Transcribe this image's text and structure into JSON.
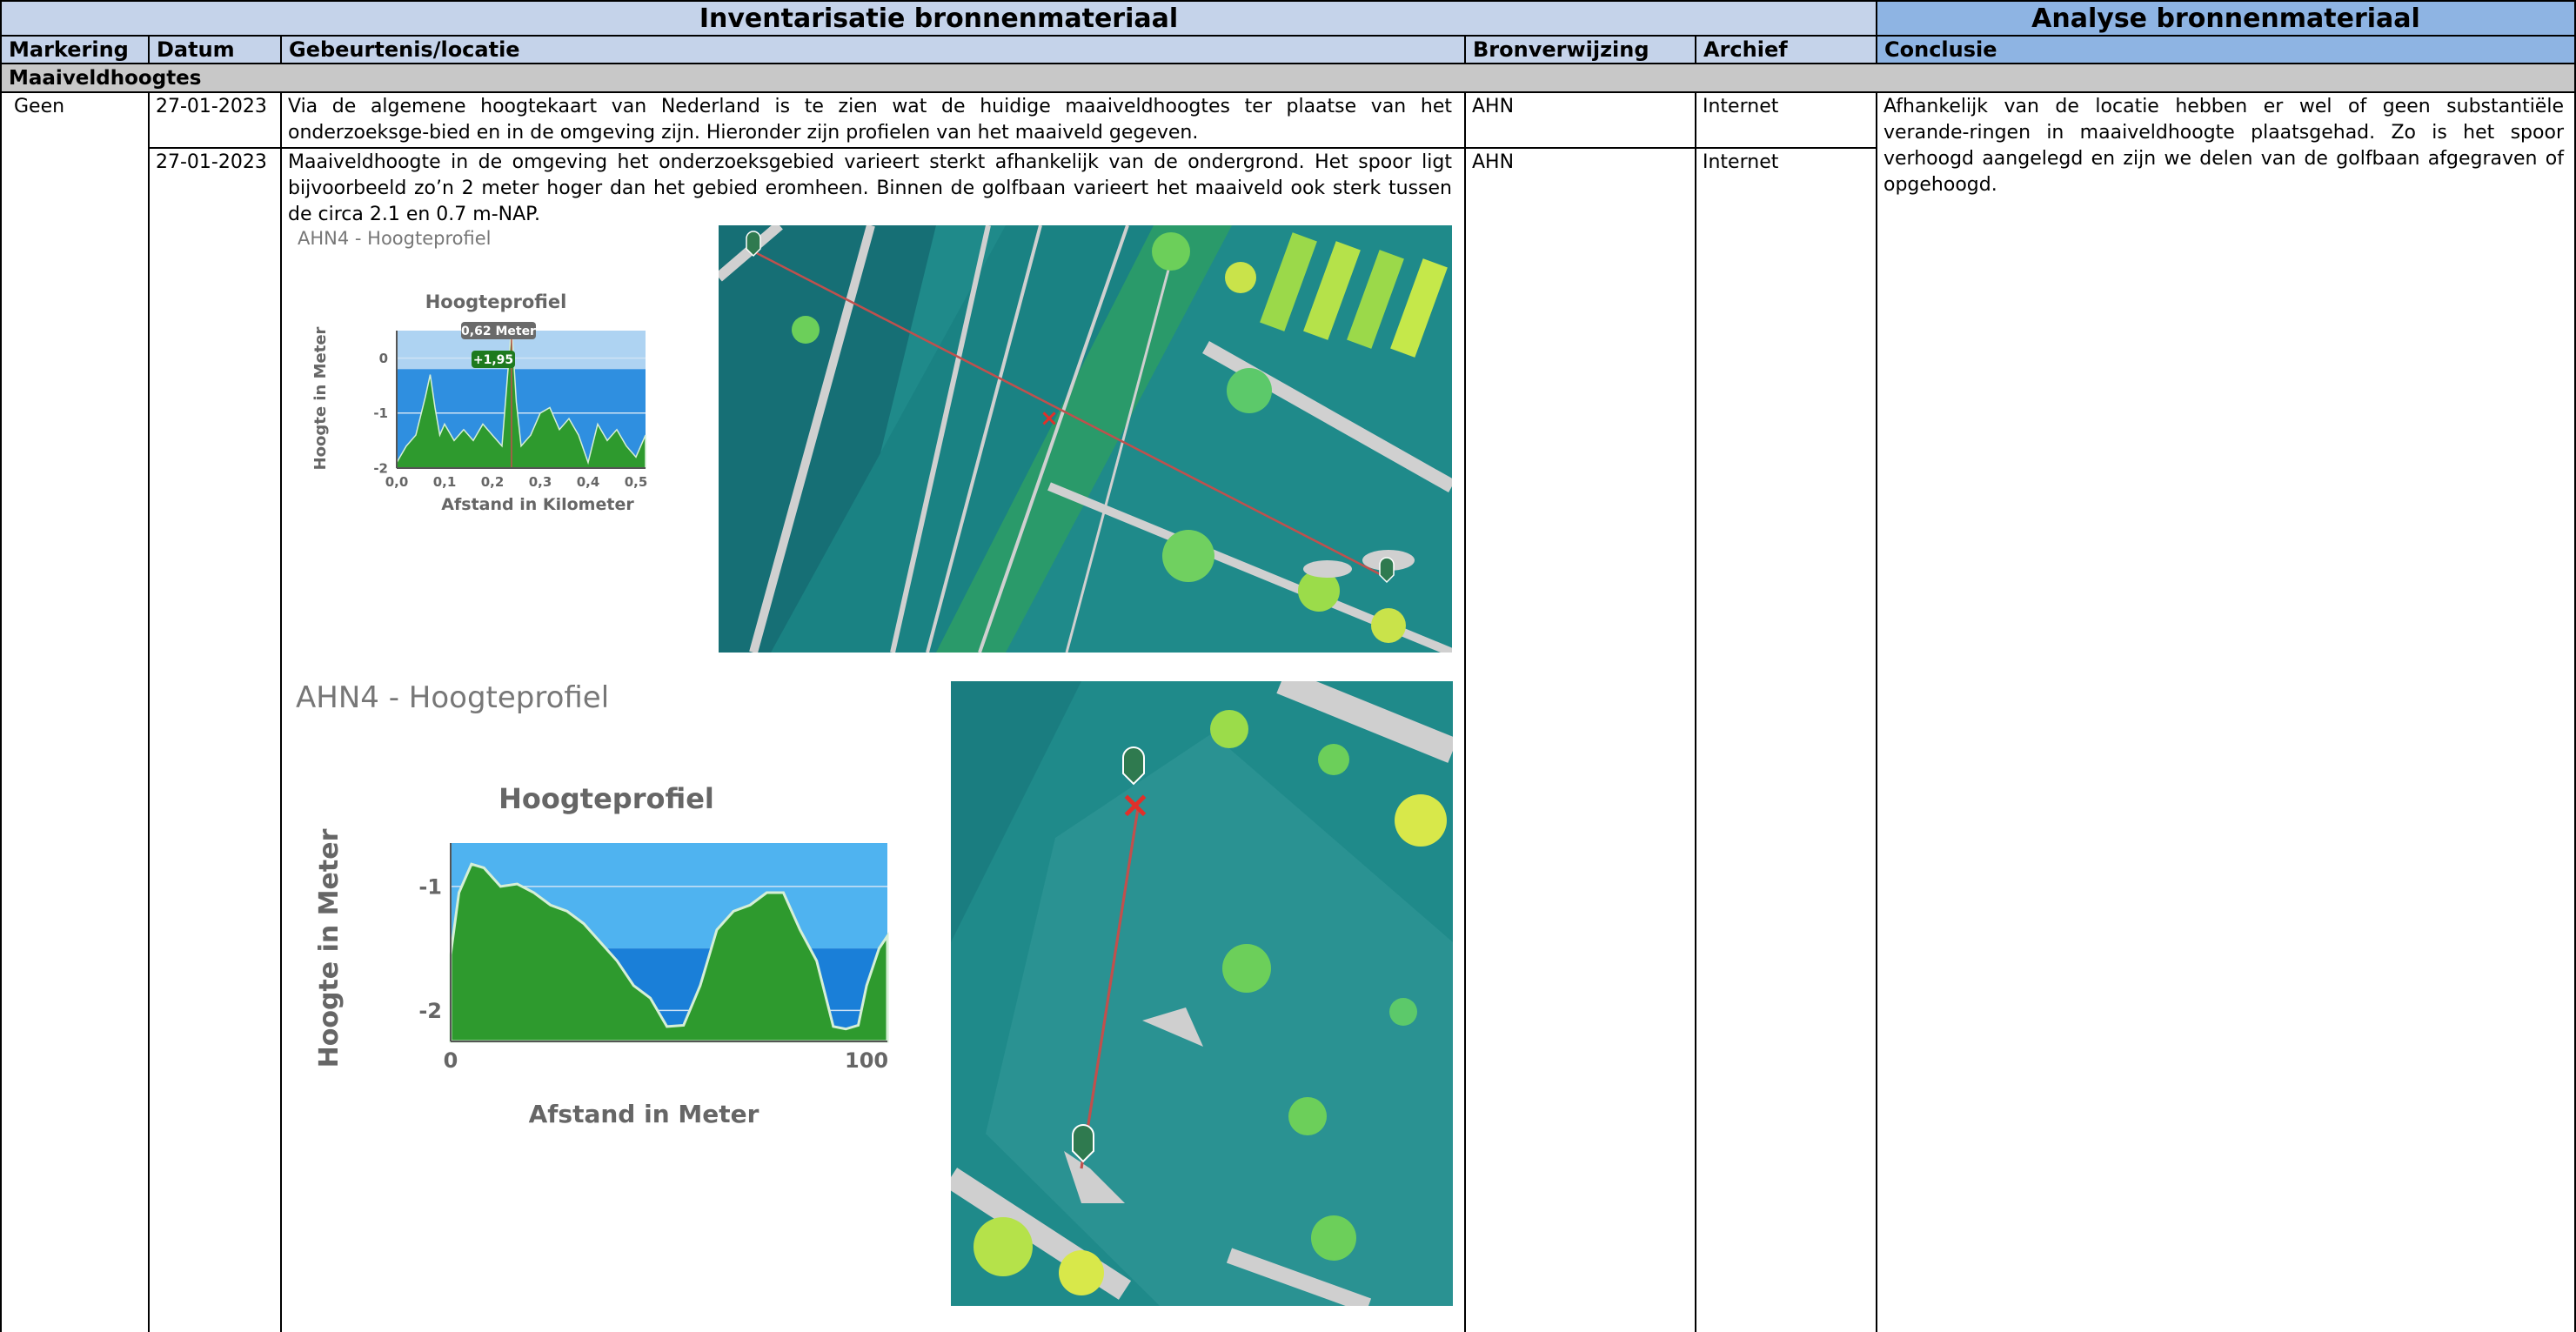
{
  "header": {
    "inventarisatie": "Inventarisatie bronnenmateriaal",
    "analyse": "Analyse bronnenmateriaal"
  },
  "columns": {
    "markering": "Markering",
    "datum": "Datum",
    "gebeurtenis": "Gebeurtenis/locatie",
    "bronverwijzing": "Bronverwijzing",
    "archief": "Archief",
    "conclusie": "Conclusie"
  },
  "section": "Maaiveldhoogtes",
  "rows": [
    {
      "markering": "Geen",
      "datum": "27-01-2023",
      "gebeurtenis": "Via de algemene hoogtekaart van Nederland is te zien wat de huidige maaiveldhoogtes ter plaatse van het onderzoeksge-bied en in de omgeving zijn. Hieronder zijn profielen van het maaiveld gegeven.",
      "bron": "AHN",
      "archief": "Internet"
    },
    {
      "datum": "27-01-2023",
      "gebeurtenis": "Maaiveldhoogte in de omgeving het onderzoeksgebied varieert sterkt afhankelijk van de ondergrond. Het spoor ligt bijvoorbeeld zo’n 2 meter hoger dan het gebied eromheen. Binnen de golfbaan varieert het maaiveld ook sterk tussen de circa 2.1 en 0.7 m-NAP.",
      "bron": "AHN",
      "archief": "Internet"
    }
  ],
  "conclusie": "Afhankelijk van de locatie hebben er wel of geen substantiële verande-ringen in maaiveldhoogte plaatsgehad. Zo is het spoor verhoogd aangelegd en zijn we delen van de golfbaan afgegraven of opgehoogd.",
  "profiles": [
    {
      "panel_title": "AHN4 - Hoogteprofiel",
      "chart_title": "Hoogteprofiel",
      "ylabel": "Hoogte in Meter",
      "xlabel": "Afstand in Kilometer",
      "yticks": [
        "0",
        "-1",
        "-2"
      ],
      "xticks": [
        "0,0",
        "0,1",
        "0,2",
        "0,3",
        "0,4",
        "0,5"
      ],
      "tooltip": "0,62 Meter",
      "badge": "+1,95"
    },
    {
      "panel_title": "AHN4 - Hoogteprofiel",
      "chart_title": "Hoogteprofiel",
      "ylabel": "Hoogte in Meter",
      "xlabel": "Afstand in Meter",
      "yticks": [
        "-1",
        "-2"
      ],
      "xticks": [
        "0",
        "100"
      ]
    }
  ],
  "chart_data": [
    {
      "type": "area",
      "title": "Hoogteprofiel",
      "xlabel": "Afstand in Kilometer",
      "ylabel": "Hoogte in Meter",
      "xlim": [
        0,
        0.52
      ],
      "ylim": [
        -2,
        0.5
      ],
      "x": [
        0.0,
        0.02,
        0.04,
        0.06,
        0.07,
        0.08,
        0.09,
        0.1,
        0.12,
        0.14,
        0.16,
        0.18,
        0.2,
        0.22,
        0.23,
        0.24,
        0.25,
        0.26,
        0.28,
        0.3,
        0.32,
        0.34,
        0.36,
        0.38,
        0.4,
        0.42,
        0.44,
        0.46,
        0.48,
        0.5,
        0.52
      ],
      "y": [
        -1.9,
        -1.6,
        -1.4,
        -0.7,
        -0.3,
        -0.9,
        -1.4,
        -1.2,
        -1.5,
        -1.3,
        -1.5,
        -1.2,
        -1.4,
        -1.6,
        -0.5,
        0.6,
        -0.8,
        -1.6,
        -1.4,
        -1.0,
        -0.9,
        -1.3,
        -1.1,
        -1.4,
        -1.9,
        -1.2,
        -1.5,
        -1.3,
        -1.6,
        -1.8,
        -1.4
      ],
      "cursor_x": 0.24,
      "colors": {
        "area": "#2e9a2e",
        "above": "#aed3f2",
        "below": "#2f8fe0"
      }
    },
    {
      "type": "area",
      "title": "Hoogteprofiel",
      "xlabel": "Afstand in Meter",
      "ylabel": "Hoogte in Meter",
      "xlim": [
        0,
        105
      ],
      "ylim": [
        -2.25,
        -0.65
      ],
      "x": [
        0,
        2,
        5,
        8,
        12,
        16,
        20,
        24,
        28,
        32,
        36,
        40,
        44,
        48,
        52,
        56,
        60,
        64,
        68,
        72,
        76,
        80,
        84,
        88,
        92,
        95,
        98,
        100,
        103,
        105
      ],
      "y": [
        -1.55,
        -1.05,
        -0.82,
        -0.85,
        -1.0,
        -0.98,
        -1.05,
        -1.15,
        -1.2,
        -1.3,
        -1.45,
        -1.6,
        -1.8,
        -1.9,
        -2.13,
        -2.12,
        -1.8,
        -1.35,
        -1.2,
        -1.15,
        -1.05,
        -1.05,
        -1.35,
        -1.6,
        -2.13,
        -2.15,
        -2.12,
        -1.8,
        -1.5,
        -1.4
      ],
      "colors": {
        "area": "#2e9a2e",
        "above": "#4fb3f0",
        "below": "#1a7fd8"
      }
    }
  ],
  "map_colors": {
    "base": "#1f8a8a",
    "dark": "#166f75",
    "road": "#cfcfcf",
    "green": "#5cc96a",
    "yellow": "#d8e84a",
    "line": "#c0504d",
    "marker": "#2f7a4f"
  }
}
